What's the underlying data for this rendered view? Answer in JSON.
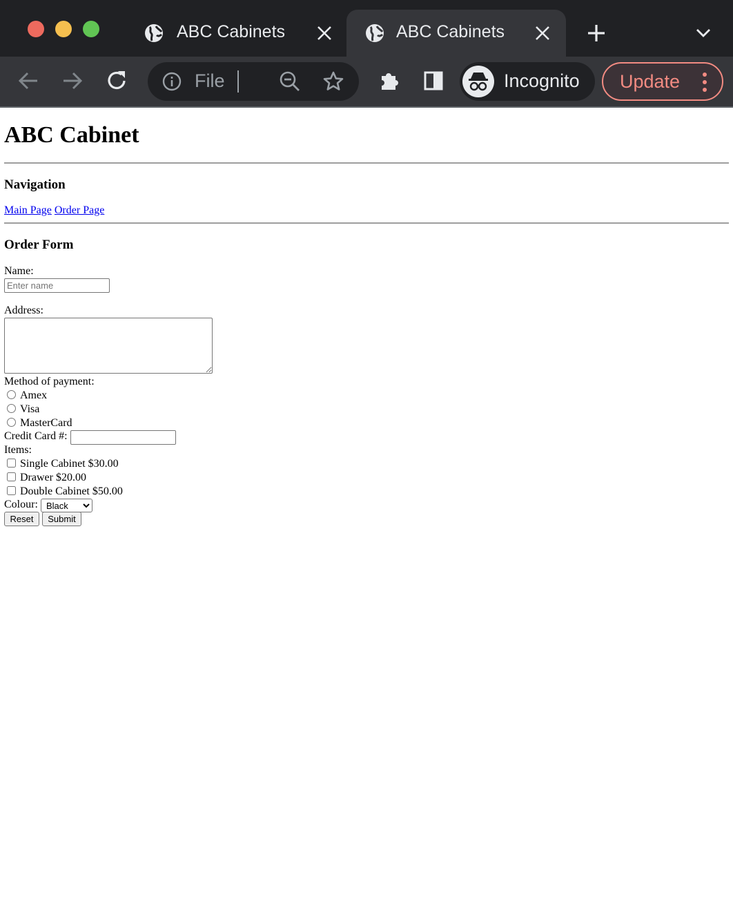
{
  "browser": {
    "tabs": [
      {
        "title": "ABC Cabinets",
        "active": false,
        "icon": "globe-icon"
      },
      {
        "title": "ABC Cabinets",
        "active": true,
        "icon": "globe-icon"
      }
    ],
    "address_bar": {
      "text": "File"
    },
    "profile_label": "Incognito",
    "update_label": "Update"
  },
  "page": {
    "title": "ABC Cabinet",
    "navigation": {
      "heading": "Navigation",
      "links": [
        "Main Page",
        "Order Page"
      ]
    },
    "form": {
      "heading": "Order Form",
      "name_label": "Name:",
      "name_placeholder": "Enter name",
      "address_label": "Address:",
      "payment_label": "Method of payment:",
      "payment_options": [
        "Amex",
        "Visa",
        "MasterCard"
      ],
      "credit_card_label": "Credit Card #:",
      "items_label": "Items:",
      "items": [
        "Single Cabinet $30.00",
        "Drawer $20.00",
        "Double Cabinet $50.00"
      ],
      "colour_label": "Colour:",
      "colour_selected": "Black",
      "reset_label": "Reset",
      "submit_label": "Submit"
    }
  },
  "colors": {
    "chrome_dark": "#202124",
    "toolbar": "#35363a",
    "link": "#0000ee",
    "update_accent": "#f28b82"
  }
}
